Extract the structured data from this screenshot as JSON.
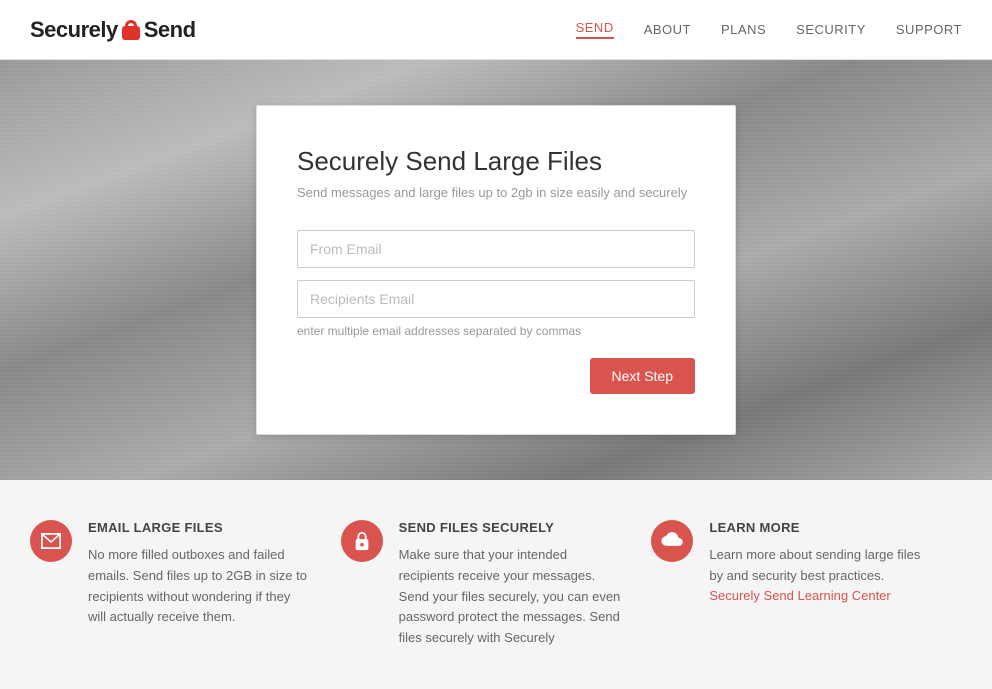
{
  "header": {
    "logo_text_before": "Securely",
    "logo_text_after": "Send",
    "nav": [
      {
        "label": "SEND",
        "active": true,
        "key": "send"
      },
      {
        "label": "ABOUT",
        "active": false,
        "key": "about"
      },
      {
        "label": "PLANS",
        "active": false,
        "key": "plans"
      },
      {
        "label": "SECURITY",
        "active": false,
        "key": "security"
      },
      {
        "label": "SUPPORT",
        "active": false,
        "key": "support"
      }
    ]
  },
  "hero": {
    "card": {
      "title": "Securely Send Large Files",
      "subtitle": "Send messages and large files up to 2gb in size easily and securely",
      "from_email_placeholder": "From Email",
      "recipients_email_placeholder": "Recipients Email",
      "hint": "enter multiple email addresses separated by commas",
      "next_button": "Next Step"
    }
  },
  "features": [
    {
      "key": "email-large-files",
      "icon": "mail",
      "title": "EMAIL LARGE FILES",
      "body": "No more filled outboxes and failed emails. Send files up to 2GB in size to recipients without wondering if they will actually receive them.",
      "link": null
    },
    {
      "key": "send-files-securely",
      "icon": "lock",
      "title": "SEND FILES SECURELY",
      "body": "Make sure that your intended recipients receive your messages. Send your files securely, you can even password protect the messages. Send files securely with Securely",
      "link": null
    },
    {
      "key": "learn-more",
      "icon": "cloud",
      "title": "LEARN MORE",
      "body": "Learn more about sending large files by and security best practices.",
      "link": "Securely Send Learning Center"
    }
  ]
}
